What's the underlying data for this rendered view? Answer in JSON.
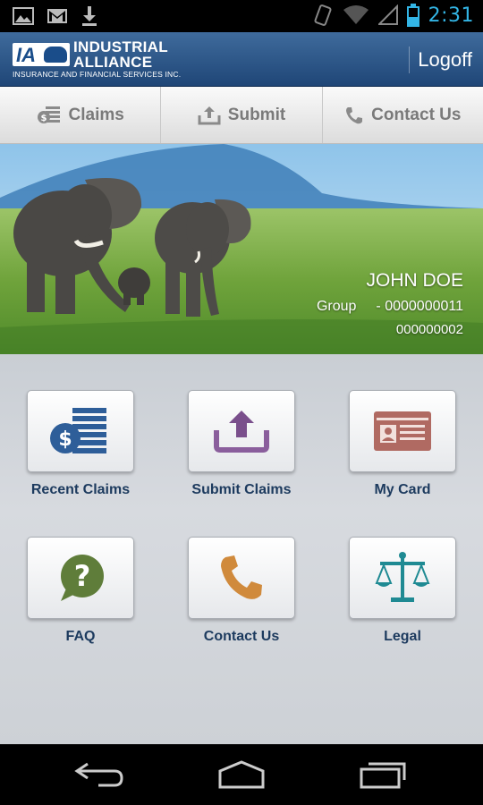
{
  "status_bar": {
    "time": "2:31"
  },
  "header": {
    "logo_line1": "INDUSTRIAL",
    "logo_line2": "ALLIANCE",
    "logo_sub": "INSURANCE AND FINANCIAL SERVICES INC.",
    "logo_mark": "IA",
    "logoff_label": "Logoff"
  },
  "tabs": [
    {
      "label": "Claims",
      "icon": "claims-icon"
    },
    {
      "label": "Submit",
      "icon": "upload-icon"
    },
    {
      "label": "Contact Us",
      "icon": "phone-icon"
    }
  ],
  "member": {
    "name": "JOHN DOE",
    "group_label": "Group",
    "group_number": "- 0000000011",
    "id_number": "000000002"
  },
  "tiles": [
    {
      "label": "Recent Claims",
      "icon": "recent-claims-icon"
    },
    {
      "label": "Submit Claims",
      "icon": "submit-claims-icon"
    },
    {
      "label": "My Card",
      "icon": "id-card-icon"
    },
    {
      "label": "FAQ",
      "icon": "question-bubble-icon"
    },
    {
      "label": "Contact Us",
      "icon": "phone-handset-icon"
    },
    {
      "label": "Legal",
      "icon": "scales-icon"
    }
  ],
  "colors": {
    "header": "#2b5588",
    "tile_label": "#1c3a5e",
    "status_time": "#33b5e5"
  }
}
